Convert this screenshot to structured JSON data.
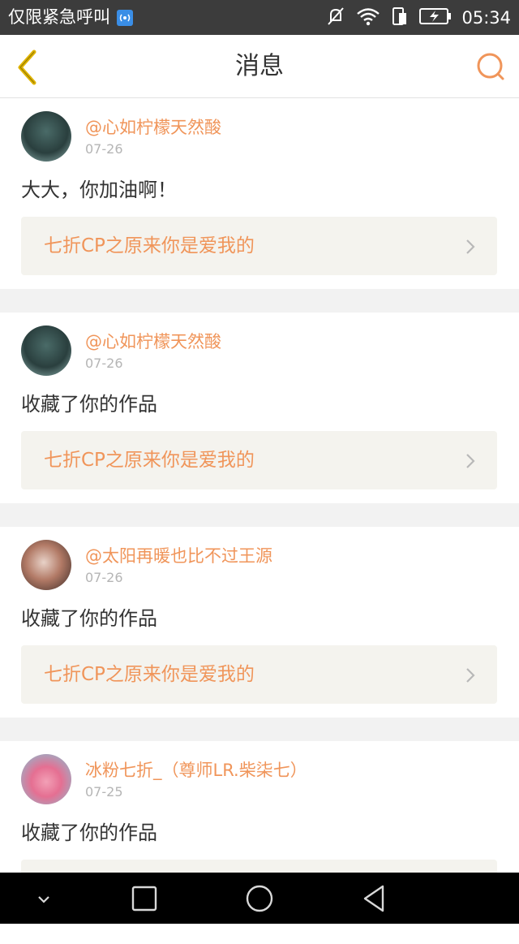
{
  "status_bar": {
    "carrier": "仅限紧急呼叫",
    "time": "05:34",
    "icons": [
      "sim-badge-icon",
      "mute-icon",
      "wifi-icon",
      "vibrate-icon",
      "battery-icon"
    ]
  },
  "header": {
    "title": "消息",
    "back_icon": "chevron-left-icon",
    "search_icon": "search-icon"
  },
  "colors": {
    "accent": "#f0955a",
    "back_icon": "#e0b400",
    "page_bg": "#f2f2f2",
    "link_bg": "#f4f3ee"
  },
  "notifications": [
    {
      "username": "@心如柠檬天然酸",
      "date": "07-26",
      "message": "大大，你加油啊！",
      "work_title": "七折CP之原来你是爱我的"
    },
    {
      "username": "@心如柠檬天然酸",
      "date": "07-26",
      "message": "收藏了你的作品",
      "work_title": "七折CP之原来你是爱我的"
    },
    {
      "username": "@太阳再暖也比不过王源",
      "date": "07-26",
      "message": "收藏了你的作品",
      "work_title": "七折CP之原来你是爱我的"
    },
    {
      "username": "冰粉七折_（尊师LR.柴柒七）",
      "date": "07-25",
      "message": "收藏了你的作品",
      "work_title": ""
    }
  ],
  "nav_bar": {
    "icons": [
      "collapse-icon",
      "recents-icon",
      "home-icon",
      "back-icon"
    ]
  }
}
